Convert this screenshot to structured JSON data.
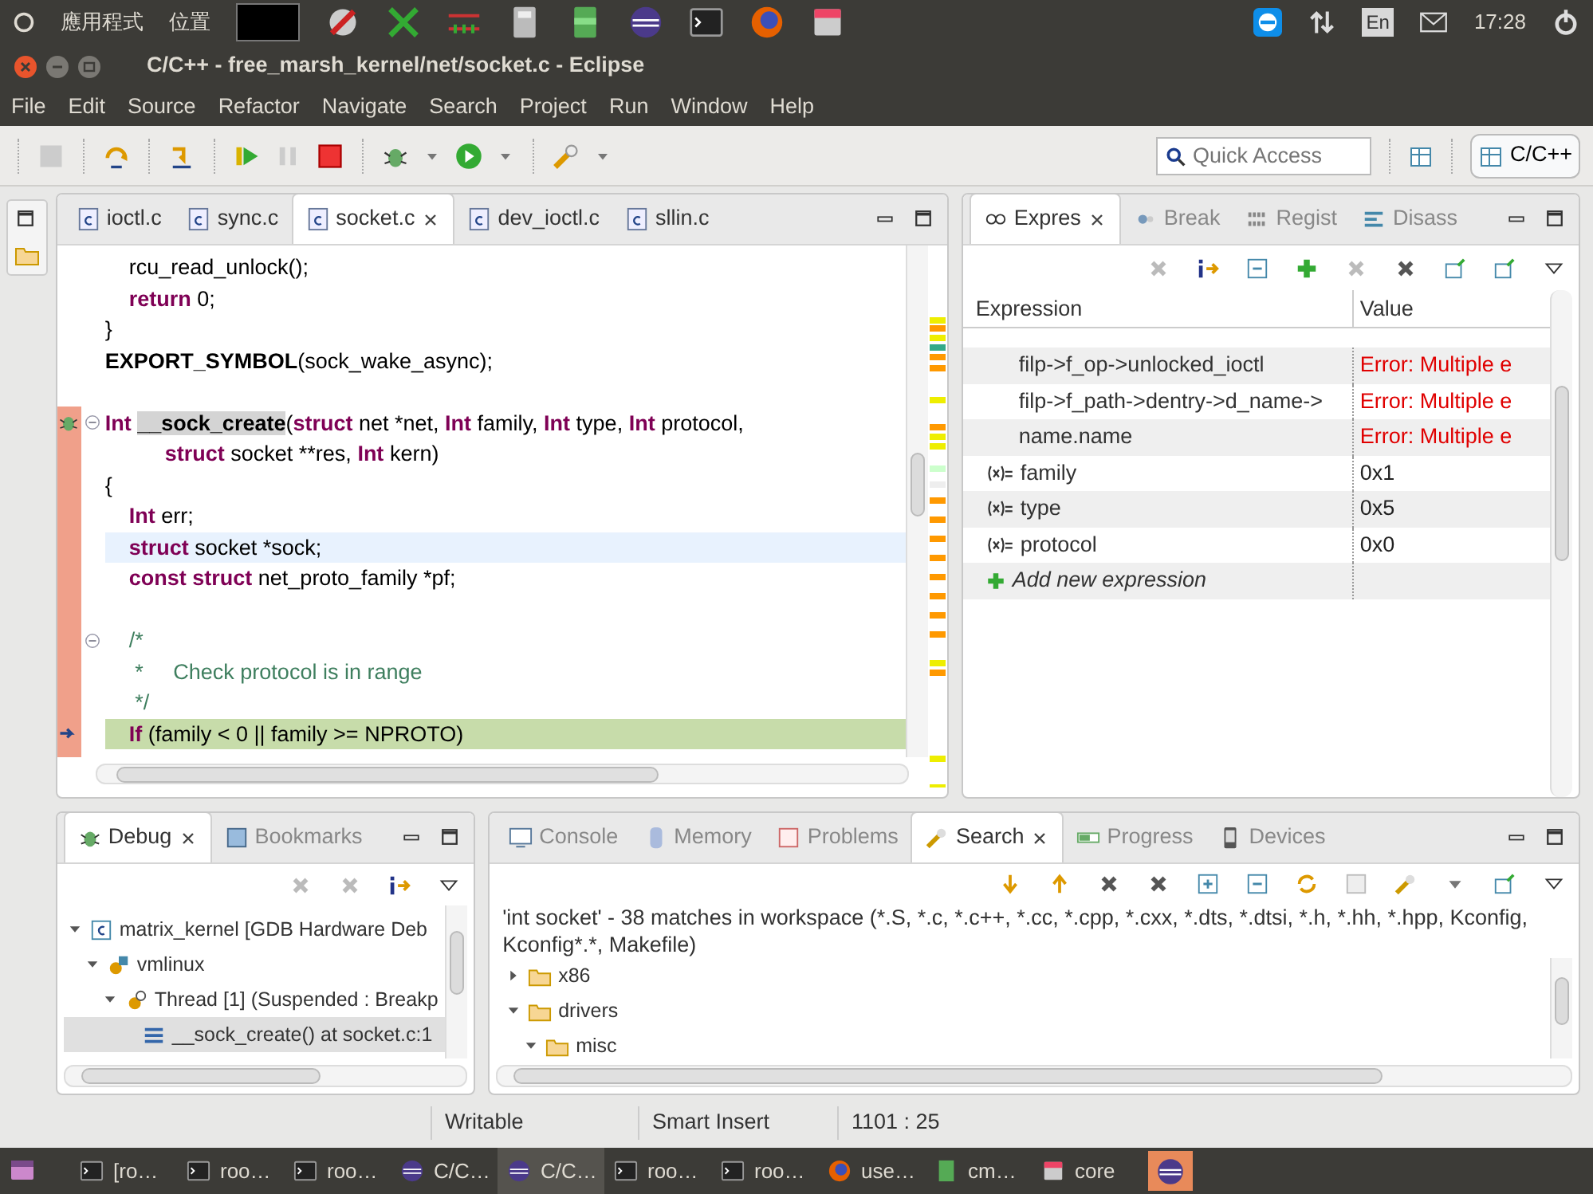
{
  "top_panel": {
    "apps_menu": "應用程式",
    "places_menu": "位置",
    "keyboard_layout": "En",
    "clock": "17:28"
  },
  "window": {
    "title": "C/C++ - free_marsh_kernel/net/socket.c - Eclipse"
  },
  "menu": [
    "File",
    "Edit",
    "Source",
    "Refactor",
    "Navigate",
    "Search",
    "Project",
    "Run",
    "Window",
    "Help"
  ],
  "toolbar": {
    "quick_access": {
      "placeholder": "Quick Access"
    },
    "perspective": "C/C++"
  },
  "editor": {
    "tabs": [
      {
        "label": "ioctl.c",
        "selected": false
      },
      {
        "label": "sync.c",
        "selected": false
      },
      {
        "label": "socket.c",
        "selected": true
      },
      {
        "label": "dev_ioctl.c",
        "selected": false
      },
      {
        "label": "sllin.c",
        "selected": false
      }
    ],
    "lines": [
      {
        "tokens": [
          {
            "kind": "text",
            "text": "    rcu_read_unlock();"
          }
        ]
      },
      {
        "tokens": [
          {
            "kind": "keyword",
            "text": "    return"
          },
          {
            "kind": "text",
            "text": " 0;"
          }
        ]
      },
      {
        "tokens": [
          {
            "kind": "text",
            "text": "}"
          }
        ]
      },
      {
        "blank_line_after": true,
        "tokens": [
          {
            "kind": "macro",
            "text": "EXPORT_SYMBOL"
          },
          {
            "kind": "text",
            "text": "(sock_wake_async);"
          }
        ]
      },
      {
        "breakpoint": true,
        "fold": true,
        "tokens": [
          {
            "kind": "keyword",
            "text": "Int "
          },
          {
            "kind": "function",
            "text": "__sock_create"
          },
          {
            "kind": "text",
            "text": "("
          },
          {
            "kind": "keyword",
            "text": "struct"
          },
          {
            "kind": "text",
            "text": " net *net, "
          },
          {
            "kind": "keyword",
            "text": "Int"
          },
          {
            "kind": "text",
            "text": " family, "
          },
          {
            "kind": "keyword",
            "text": "Int"
          },
          {
            "kind": "text",
            "text": " type, "
          },
          {
            "kind": "keyword",
            "text": "Int"
          },
          {
            "kind": "text",
            "text": " protocol,"
          }
        ]
      },
      {
        "tokens": [
          {
            "kind": "keyword",
            "text": "          struct"
          },
          {
            "kind": "text",
            "text": " socket **res, "
          },
          {
            "kind": "keyword",
            "text": "Int"
          },
          {
            "kind": "text",
            "text": " kern)"
          }
        ]
      },
      {
        "tokens": [
          {
            "kind": "text",
            "text": "{"
          }
        ]
      },
      {
        "tokens": [
          {
            "kind": "keyword",
            "text": "    Int"
          },
          {
            "kind": "text",
            "text": " err;"
          }
        ]
      },
      {
        "current_line": true,
        "tokens": [
          {
            "kind": "keyword",
            "text": "    struct"
          },
          {
            "kind": "text",
            "text": " socket *sock;"
          }
        ]
      },
      {
        "blank_line_after": true,
        "tokens": [
          {
            "kind": "keyword",
            "text": "    const struct"
          },
          {
            "kind": "text",
            "text": " net_proto_family *pf;"
          }
        ]
      },
      {
        "fold": true,
        "tokens": [
          {
            "kind": "comment",
            "text": "    /*"
          }
        ]
      },
      {
        "tokens": [
          {
            "kind": "comment",
            "text": "     *     Check protocol is in range"
          }
        ]
      },
      {
        "tokens": [
          {
            "kind": "comment",
            "text": "     */"
          }
        ]
      },
      {
        "instruction_pointer": true,
        "suspended_line": true,
        "tokens": [
          {
            "kind": "keyword",
            "text": "    If"
          },
          {
            "kind": "text",
            "text": " (family < 0 || family >= NPROTO)"
          }
        ]
      }
    ]
  },
  "expressions_view": {
    "tabs": [
      {
        "label": "Expres",
        "selected": true
      },
      {
        "label": "Break",
        "selected": false
      },
      {
        "label": "Regist",
        "selected": false
      },
      {
        "label": "Disass",
        "selected": false
      }
    ],
    "columns": [
      "Expression",
      "Value"
    ],
    "rows": [
      {
        "kind": "child",
        "expression": "filp->f_op->unlocked_ioctl",
        "value": "Error: Multiple e",
        "error": true
      },
      {
        "kind": "child",
        "expression": "filp->f_path->dentry->d_name->",
        "value": "Error: Multiple e",
        "error": true
      },
      {
        "kind": "child",
        "expression": "name.name",
        "value": "Error: Multiple e",
        "error": true
      },
      {
        "kind": "variable",
        "expression": "family",
        "value": "0x1",
        "error": false
      },
      {
        "kind": "variable",
        "expression": "type",
        "value": "0x5",
        "error": false
      },
      {
        "kind": "variable",
        "expression": "protocol",
        "value": "0x0",
        "error": false
      },
      {
        "kind": "add",
        "expression": "Add new expression"
      }
    ]
  },
  "debug_view": {
    "tabs": [
      {
        "label": "Debug",
        "selected": true
      },
      {
        "label": "Bookmarks",
        "selected": false
      }
    ],
    "tree": [
      {
        "kind": "project",
        "label": "matrix_kernel [GDB Hardware Deb",
        "expanded": true,
        "selected": false,
        "children": [
          {
            "kind": "process",
            "label": "vmlinux",
            "expanded": true,
            "selected": false,
            "children": [
              {
                "kind": "thread",
                "label": "Thread [1] (Suspended : Breakp",
                "expanded": true,
                "selected": false,
                "children": [
                  {
                    "kind": "frame",
                    "label": "__sock_create() at socket.c:1",
                    "selected": true
                  }
                ]
              }
            ]
          }
        ]
      }
    ]
  },
  "search_view": {
    "tabs": [
      {
        "label": "Console",
        "selected": false
      },
      {
        "label": "Memory",
        "selected": false
      },
      {
        "label": "Problems",
        "selected": false
      },
      {
        "label": "Search",
        "selected": true
      },
      {
        "label": "Progress",
        "selected": false
      },
      {
        "label": "Devices",
        "selected": false
      }
    ],
    "summary": "'int socket' - 38 matches in workspace (*.S, *.c, *.c++, *.cc, *.cpp, *.cxx, *.dts, *.dtsi, *.h, *.hh, *.hpp, Kconfig, Kconfig*.*, Makefile)",
    "tree": [
      {
        "label": "x86",
        "expanded": false
      },
      {
        "label": "drivers",
        "expanded": true,
        "children": [
          {
            "label": "misc",
            "expanded": true
          }
        ]
      }
    ]
  },
  "status_bar": [
    "Writable",
    "Smart Insert",
    "1101 : 25"
  ],
  "taskbar": [
    {
      "kind": "terminal",
      "label": "[ro…",
      "selected": false
    },
    {
      "kind": "terminal",
      "label": "roo…",
      "selected": false
    },
    {
      "kind": "terminal",
      "label": "roo…",
      "selected": false
    },
    {
      "kind": "eclipse",
      "label": "C/C…",
      "selected": false
    },
    {
      "kind": "eclipse",
      "label": "C/C…",
      "selected": true
    },
    {
      "kind": "terminal",
      "label": "roo…",
      "selected": false
    },
    {
      "kind": "terminal",
      "label": "roo…",
      "selected": false
    },
    {
      "kind": "firefox",
      "label": "use…",
      "selected": false
    },
    {
      "kind": "notepad",
      "label": "cm…",
      "selected": false
    },
    {
      "kind": "files",
      "label": "core",
      "selected": false
    }
  ]
}
